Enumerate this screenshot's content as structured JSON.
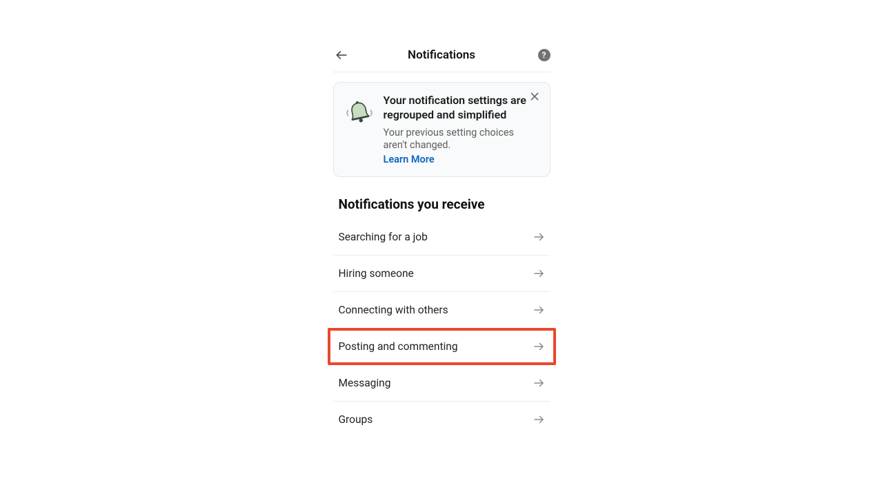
{
  "header": {
    "title": "Notifications"
  },
  "info_card": {
    "title": "Your notification settings are regrouped and simplified",
    "subtitle": "Your previous setting choices aren't changed.",
    "learn_more": "Learn More"
  },
  "section": {
    "title": "Notifications you receive"
  },
  "rows": [
    {
      "label": "Searching for a job",
      "highlighted": false
    },
    {
      "label": "Hiring someone",
      "highlighted": false
    },
    {
      "label": "Connecting with others",
      "highlighted": false
    },
    {
      "label": "Posting and commenting",
      "highlighted": true
    },
    {
      "label": "Messaging",
      "highlighted": false
    },
    {
      "label": "Groups",
      "highlighted": false
    }
  ]
}
